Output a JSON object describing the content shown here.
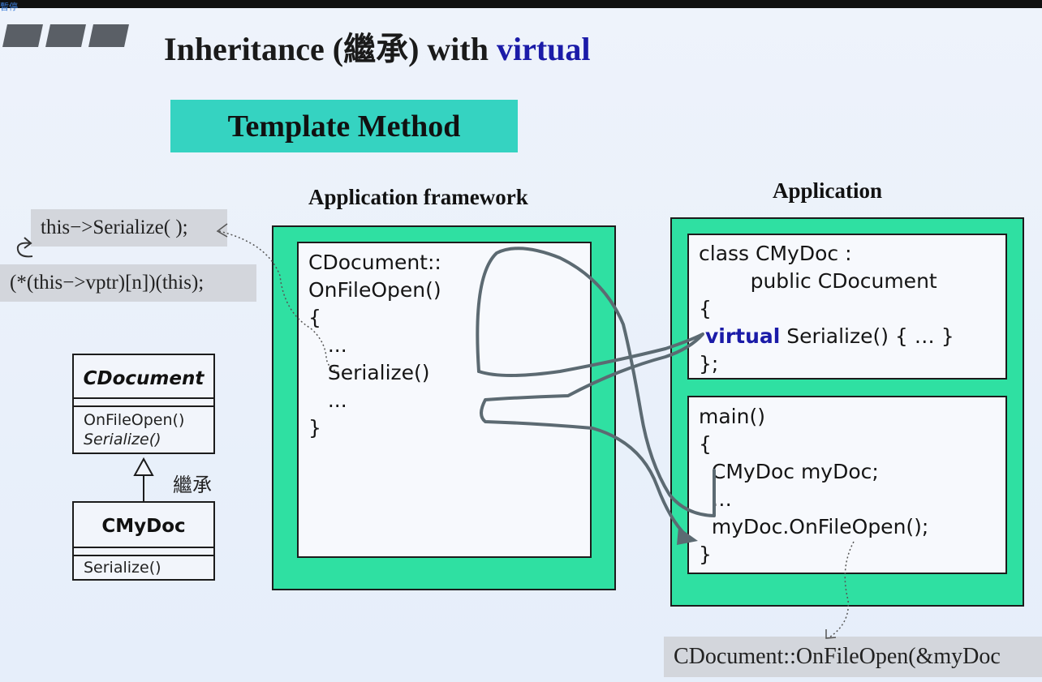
{
  "overlay_label": "暫停",
  "title": {
    "prefix": "Inheritance (繼承) with ",
    "keyword": "virtual"
  },
  "banner": "Template Method",
  "headers": {
    "framework": "Application framework",
    "application": "Application"
  },
  "callouts": {
    "this_call": "this−>Serialize( );",
    "vptr_call": "(*(this−>vptr)[n])(this);",
    "bottom_call": "CDocument::OnFileOpen(&myDoc"
  },
  "framework_code": [
    "CDocument::",
    "OnFileOpen()",
    "{",
    "   ...",
    "   Serialize()",
    "   ...",
    "}"
  ],
  "app_class_code": {
    "line1": "class CMyDoc :",
    "line2": "        public CDocument",
    "line3": "{",
    "virtual_kw": "virtual",
    "virtual_rest": " Serialize() { … }",
    "line5": "};"
  },
  "app_main_code": [
    "main()",
    "{",
    "  CMyDoc myDoc;",
    "  …",
    "  myDoc.OnFileOpen();",
    "}"
  ],
  "uml": {
    "base_name": "CDocument",
    "base_ops": [
      "OnFileOpen()",
      "Serialize()"
    ],
    "inherit_label": "繼承",
    "derived_name": "CMyDoc",
    "derived_ops": [
      "Serialize()"
    ]
  },
  "colors": {
    "green": "#2fe0a2",
    "teal": "#35d3c1",
    "keyword_blue": "#1b1ba8",
    "callout_gray": "#d3d6dc"
  }
}
